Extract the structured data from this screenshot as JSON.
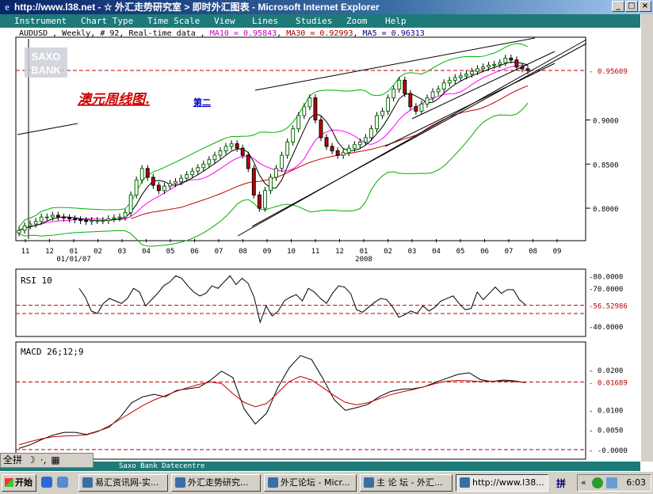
{
  "window": {
    "title": "http://www.l38.net - ☆ 外汇走势研究室 > 即时外汇图表 - Microsoft Internet Explorer",
    "minimize": "_",
    "maximize": "□",
    "close": "×"
  },
  "menu": [
    "Instrument",
    "Chart Type",
    "Time Scale",
    "View",
    "Lines",
    "Studies",
    "Zoom",
    "Help"
  ],
  "header": {
    "symbol": "AUDUSD , Weekly, # 92, Real-time data ,",
    "ma10": "MA10 = 0.95843",
    "ma30": "MA30 = 0.92993",
    "ma5": "MA5 = 0.96313"
  },
  "watermark": {
    "line1": "SAXO",
    "line2": "BANK"
  },
  "annotation": {
    "main": "澳元周线图.",
    "sub": "第二"
  },
  "chart_data": [
    {
      "type": "candlestick",
      "title": "AUDUSD , Weekly, # 92, Real-time data",
      "ylim": [
        0.765,
        0.992
      ],
      "yticks": [
        0.8,
        0.85,
        0.9
      ],
      "ytick_labels": [
        "0.8000",
        "0.8500",
        "0.9000"
      ],
      "last_price": 0.95609,
      "last_price_label": "0.95609",
      "x_month_labels": [
        "11",
        "12",
        "01",
        "02",
        "03",
        "04",
        "05",
        "06",
        "07",
        "08",
        "09",
        "10",
        "11",
        "12",
        "01",
        "02",
        "03",
        "04",
        "05",
        "06",
        "07",
        "08",
        "09"
      ],
      "x_date_labels": [
        {
          "label": "01/01/07",
          "month_index": 2
        },
        {
          "label": "2008",
          "month_index": 14
        }
      ],
      "approx_close": [
        0.775,
        0.78,
        0.782,
        0.785,
        0.79,
        0.79,
        0.792,
        0.79,
        0.789,
        0.788,
        0.787,
        0.786,
        0.785,
        0.786,
        0.786,
        0.786,
        0.788,
        0.789,
        0.79,
        0.795,
        0.815,
        0.832,
        0.845,
        0.835,
        0.826,
        0.82,
        0.825,
        0.828,
        0.83,
        0.834,
        0.838,
        0.842,
        0.846,
        0.85,
        0.855,
        0.86,
        0.865,
        0.87,
        0.873,
        0.868,
        0.86,
        0.845,
        0.815,
        0.8,
        0.82,
        0.835,
        0.845,
        0.86,
        0.875,
        0.89,
        0.905,
        0.915,
        0.925,
        0.9,
        0.88,
        0.87,
        0.865,
        0.86,
        0.863,
        0.868,
        0.872,
        0.875,
        0.88,
        0.89,
        0.905,
        0.91,
        0.925,
        0.935,
        0.945,
        0.93,
        0.915,
        0.91,
        0.918,
        0.925,
        0.932,
        0.935,
        0.942,
        0.945,
        0.948,
        0.95,
        0.952,
        0.955,
        0.958,
        0.96,
        0.962,
        0.963,
        0.965,
        0.97,
        0.968,
        0.96,
        0.958,
        0.956
      ]
    },
    {
      "type": "line",
      "title": "RSI 10",
      "ylim": [
        33,
        84
      ],
      "yticks": [
        80,
        70,
        56.52986,
        40
      ],
      "ytick_labels": [
        "80.0000",
        "70.0000",
        "56.52986",
        "40.0000"
      ],
      "reference_lines": [
        56.52986,
        50
      ],
      "values": [
        70,
        63,
        52,
        50,
        58,
        62,
        60,
        58,
        62,
        70,
        67,
        56,
        61,
        66,
        72,
        75,
        80,
        78,
        72,
        67,
        64,
        66,
        72,
        70,
        75,
        80,
        73,
        78,
        74,
        63,
        43,
        56,
        48,
        52,
        60,
        63,
        65,
        60,
        70,
        67,
        62,
        58,
        66,
        72,
        71,
        66,
        53,
        51,
        55,
        59,
        62,
        61,
        55,
        47,
        49,
        52,
        50,
        56,
        52,
        55,
        60,
        62,
        64,
        58,
        53,
        54,
        67,
        61,
        66,
        71,
        66,
        69,
        69,
        61,
        57
      ]
    },
    {
      "type": "line",
      "title": "MACD 26;12;9",
      "ylim": [
        -0.002,
        0.0265
      ],
      "yticks": [
        0.02,
        0.01689,
        0.01,
        0.005,
        0.0
      ],
      "ytick_labels": [
        "0.0200",
        "0.01689",
        "0.0100",
        "0.0050",
        "-0.0000"
      ],
      "reference_lines": [
        0.01689,
        0.0
      ],
      "series": [
        {
          "name": "MACD",
          "values": [
            0.0003,
            0.0012,
            0.0025,
            0.0036,
            0.0043,
            0.0043,
            0.0038,
            0.0046,
            0.0056,
            0.0081,
            0.0117,
            0.0132,
            0.0138,
            0.0132,
            0.0148,
            0.0152,
            0.0156,
            0.0173,
            0.0196,
            0.018,
            0.0102,
            0.0064,
            0.0091,
            0.0155,
            0.0204,
            0.0235,
            0.0225,
            0.0178,
            0.0125,
            0.0098,
            0.0105,
            0.0113,
            0.0132,
            0.0145,
            0.0151,
            0.0152,
            0.0157,
            0.0168,
            0.0178,
            0.0188,
            0.0192,
            0.0175,
            0.017,
            0.0174,
            0.0172,
            0.0167
          ]
        },
        {
          "name": "Signal",
          "values": [
            0.0012,
            0.002,
            0.0027,
            0.0032,
            0.0034,
            0.0035,
            0.0037,
            0.0045,
            0.0059,
            0.0076,
            0.0093,
            0.011,
            0.0124,
            0.0135,
            0.0146,
            0.0155,
            0.0163,
            0.0169,
            0.0165,
            0.014,
            0.0118,
            0.0107,
            0.0115,
            0.0142,
            0.017,
            0.0183,
            0.0174,
            0.0155,
            0.0135,
            0.0118,
            0.0112,
            0.0117,
            0.0127,
            0.0137,
            0.0144,
            0.015,
            0.0157,
            0.0165,
            0.0171,
            0.0173,
            0.0172,
            0.017,
            0.0171,
            0.0171,
            0.017,
            0.0168
          ]
        }
      ]
    }
  ],
  "status": "Saxo Bank Datecentre",
  "ime": {
    "mode": "全拼",
    "moon": "☽",
    "punct": "·,",
    "kbd": "▦"
  },
  "taskbar": {
    "start": "开始",
    "tasks": [
      "易汇资讯网-实...",
      "外汇走势研究...",
      "外汇论坛 - Micr...",
      "主 论 坛 - 外汇...",
      "http://www.l38..."
    ],
    "ime_tray": "拼",
    "clock": "6:03"
  },
  "colors": {
    "up": "#007000",
    "down": "#c00000",
    "ma": "#ff00ff",
    "ma30": "#c00000",
    "bb": "#00b000",
    "ref": "#c00000",
    "menubar": "#1e7a78"
  }
}
